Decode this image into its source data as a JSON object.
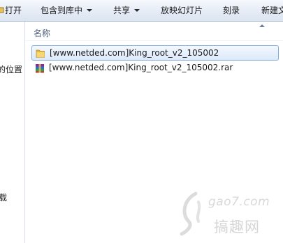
{
  "toolbar": {
    "open_label": "打开",
    "include_library_label": "包含到库中",
    "share_label": "共享",
    "slideshow_label": "放映幻灯片",
    "burn_label": "刻录",
    "new_folder_label": "新建文"
  },
  "nav": {
    "partial_location": "的位置",
    "partial_disk": "载"
  },
  "content": {
    "column_name": "名称",
    "files": [
      {
        "name": "[www.netded.com]King_root_v2_105002",
        "type": "folder",
        "selected": true
      },
      {
        "name": "[www.netded.com]King_root_v2_105002.rar",
        "type": "rar-archive",
        "selected": false
      }
    ]
  },
  "watermark": {
    "url": "gao7.com",
    "name": "搞趣网"
  },
  "colors": {
    "toolbar_top": "#f6f9fd",
    "toolbar_bottom": "#dbe4f1",
    "selection_border": "#84acdd",
    "header_text": "#4c607a"
  }
}
